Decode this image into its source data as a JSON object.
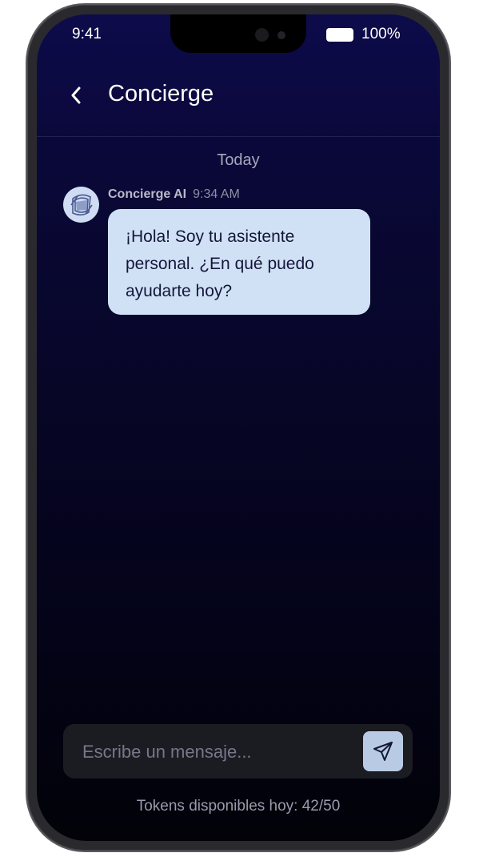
{
  "status_bar": {
    "time": "9:41",
    "battery_percent": "100%"
  },
  "header": {
    "back_icon": "chevron-left-icon",
    "title": "Concierge"
  },
  "chat": {
    "date_separator": "Today",
    "messages": [
      {
        "sender": "Concierge AI",
        "time": "9:34 AM",
        "text": "¡Hola! Soy tu asistente personal. ¿En qué puedo ayudarte hoy?",
        "avatar_icon": "concierge-logo-icon"
      }
    ]
  },
  "composer": {
    "placeholder": "Escribe un mensaje...",
    "value": "",
    "send_icon": "paper-plane-icon"
  },
  "footer": {
    "tokens_text": "Tokens disponibles hoy: 42/50"
  },
  "colors": {
    "background_top": "#0d0b4a",
    "background_bottom": "#020208",
    "bubble": "#d1e1f5",
    "bubble_text": "#13163a",
    "send_button": "#b9cbe4"
  }
}
